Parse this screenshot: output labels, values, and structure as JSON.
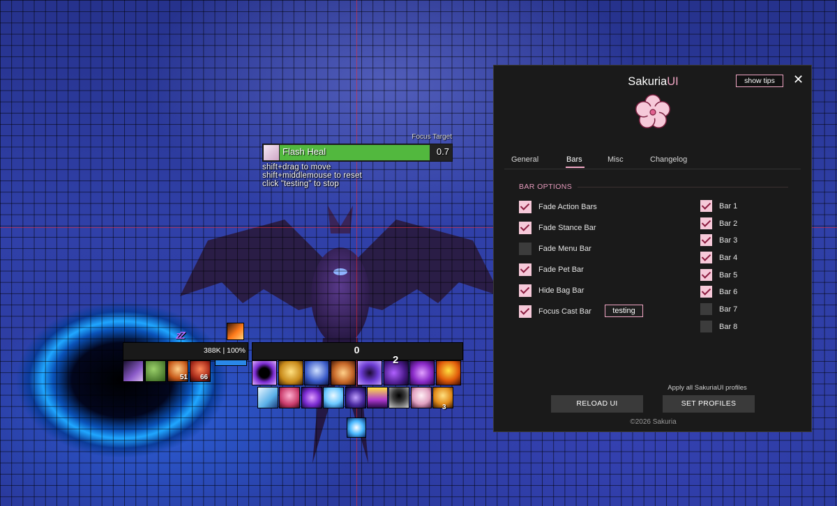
{
  "focus": {
    "label": "Focus Target",
    "spell": "Flash Heal",
    "time": "0.7",
    "progress": 0.88,
    "hints": [
      "shift+drag to move",
      "shift+middlemouse to reset",
      "click \"testing\" to stop"
    ]
  },
  "player": {
    "status_text": "388K | 100%",
    "sleep_glyph": "zZ",
    "combo_value": "0"
  },
  "action_bars": {
    "party_counts": [
      "51",
      "66"
    ],
    "row1_count": "2",
    "row2_count": "3"
  },
  "panel": {
    "title_main": "Sakuria",
    "title_accent": "UI",
    "show_tips_label": "show tips",
    "close_glyph": "✕",
    "tabs": [
      {
        "label": "General",
        "active": false
      },
      {
        "label": "Bars",
        "active": true
      },
      {
        "label": "Misc",
        "active": false
      },
      {
        "label": "Changelog",
        "active": false
      }
    ],
    "section_title": "BAR OPTIONS",
    "options": [
      {
        "label": "Fade Action Bars",
        "checked": true
      },
      {
        "label": "Fade Stance Bar",
        "checked": true
      },
      {
        "label": "Fade Menu Bar",
        "checked": false
      },
      {
        "label": "Fade Pet Bar",
        "checked": true
      },
      {
        "label": "Hide Bag Bar",
        "checked": true
      },
      {
        "label": "Focus Cast Bar",
        "checked": true
      }
    ],
    "testing_label": "testing",
    "bars": [
      {
        "label": "Bar 1",
        "checked": true
      },
      {
        "label": "Bar 2",
        "checked": true
      },
      {
        "label": "Bar 3",
        "checked": true
      },
      {
        "label": "Bar 4",
        "checked": true
      },
      {
        "label": "Bar 5",
        "checked": true
      },
      {
        "label": "Bar 6",
        "checked": true
      },
      {
        "label": "Bar 7",
        "checked": false
      },
      {
        "label": "Bar 8",
        "checked": false
      }
    ],
    "apply_note": "Apply all SakuriaUI profiles",
    "reload_label": "RELOAD UI",
    "profiles_label": "SET PROFILES",
    "copyright": "©2026 Sakuria"
  },
  "colors": {
    "accent_pink": "#f3a8c6",
    "cast_green": "#52b83e",
    "panel_bg": "#1a1a1a",
    "mana_blue": "#2a88e8"
  },
  "icons": [
    "sakura-flower-icon",
    "close-icon",
    "checkbox-icon",
    "flash-heal-spell-icon"
  ]
}
